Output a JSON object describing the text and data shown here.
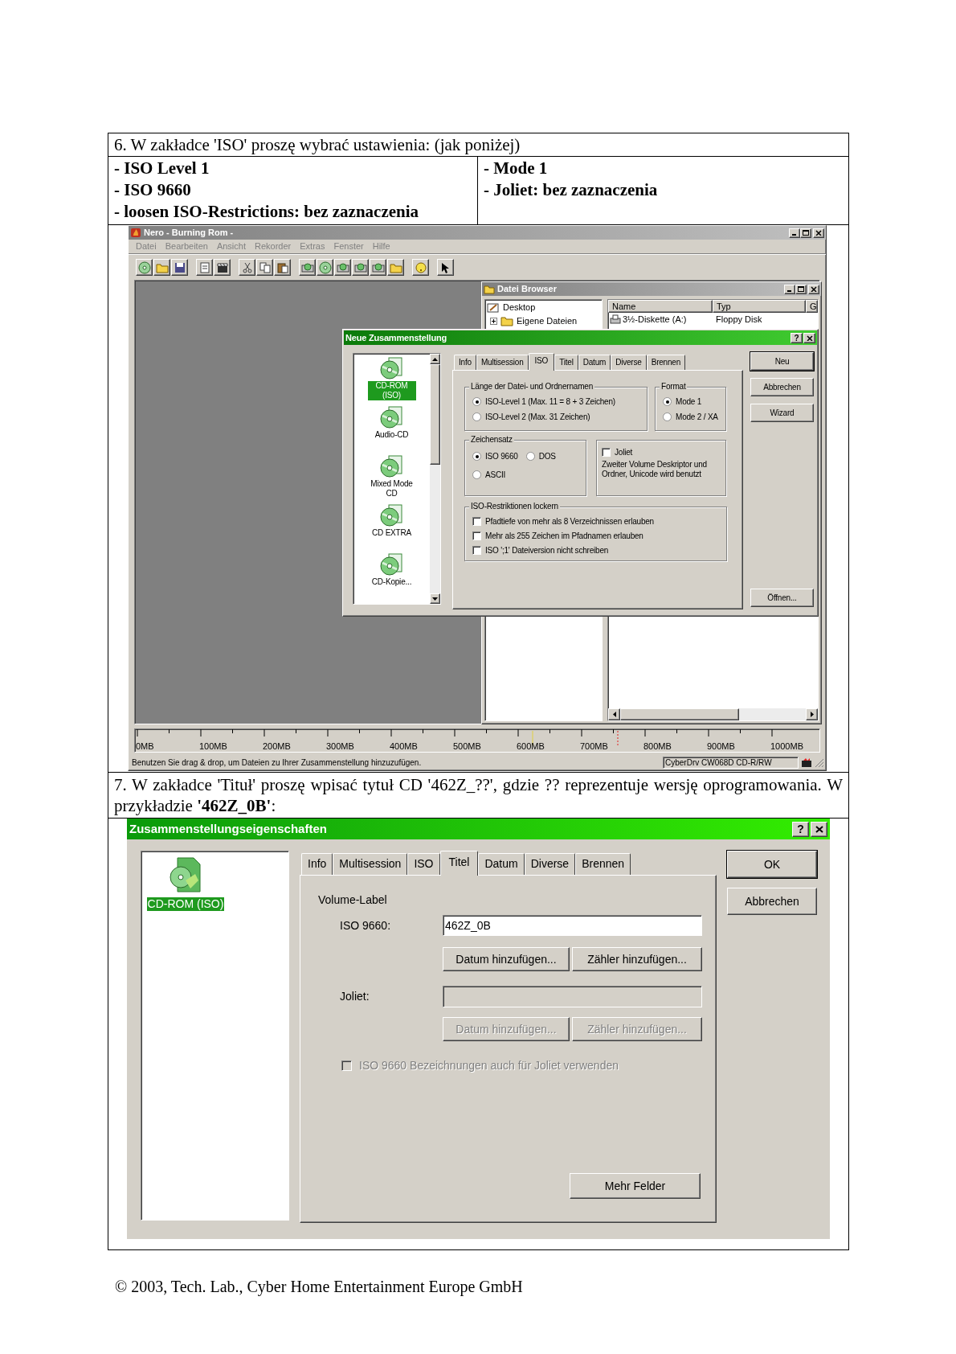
{
  "document": {
    "step6_heading": "6. W zakładce 'ISO' proszę wybrać ustawienia: (jak poniżej)",
    "settings_left": [
      "- ISO Level 1",
      "- ISO 9660",
      "- loosen ISO-Restrictions: bez zaznaczenia"
    ],
    "settings_right": [
      "- Mode 1",
      "- Joliet: bez zaznaczenia"
    ],
    "step7_text": "7. W zakładce 'Tituł' proszę wpisać tytuł CD '462Z_??', gdzie ?? reprezentuje wersję oprogramowania. W przykładzie **'462Z_0B'**:",
    "footer": "© 2003, Tech. Lab., Cyber Home Entertainment Europe GmbH"
  },
  "nero_window": {
    "title": "Nero - Burning Rom -",
    "menu": [
      "Datei",
      "Bearbeiten",
      "Ansicht",
      "Rekorder",
      "Extras",
      "Fenster",
      "Hilfe"
    ],
    "file_browser": {
      "title": "Datei Browser",
      "tree": [
        {
          "label": "Desktop",
          "children": [
            {
              "label": "Eigene Dateien",
              "expanded": false
            }
          ]
        }
      ],
      "columns": [
        "Name",
        "Typ",
        "G"
      ],
      "rows": [
        [
          "3½-Diskette (A:)",
          "Floppy Disk"
        ]
      ]
    },
    "ruler": [
      "0MB",
      "100MB",
      "200MB",
      "300MB",
      "400MB",
      "500MB",
      "600MB",
      "700MB",
      "800MB",
      "900MB",
      "1000MB"
    ],
    "status_message": "Benutzen Sie drag & drop, um Dateien zu Ihrer Zusammenstellung hinzuzufügen.",
    "recorder": "CyberDrv CW068D CD-R/RW"
  },
  "new_compilation_dialog": {
    "title": "Neue Zusammenstellung",
    "help": "?",
    "types": [
      {
        "label": "CD-ROM (ISO)",
        "selected": true
      },
      {
        "label": "Audio-CD",
        "selected": false
      },
      {
        "label": "Mixed Mode CD",
        "selected": false
      },
      {
        "label": "CD EXTRA",
        "selected": false
      },
      {
        "label": "CD-Kopie...",
        "selected": false
      }
    ],
    "tabs": [
      {
        "label": "Info",
        "selected": false
      },
      {
        "label": "Multisession",
        "selected": false
      },
      {
        "label": "ISO",
        "selected": true
      },
      {
        "label": "Titel",
        "selected": false
      },
      {
        "label": "Datum",
        "selected": false
      },
      {
        "label": "Diverse",
        "selected": false
      },
      {
        "label": "Brennen",
        "selected": false
      }
    ],
    "name_length": {
      "legend": "Länge der Datei- und Ordnernamen",
      "options": [
        {
          "label": "ISO-Level 1 (Max. 11 = 8 + 3 Zeichen)",
          "selected": true
        },
        {
          "label": "ISO-Level 2 (Max. 31 Zeichen)",
          "selected": false
        }
      ]
    },
    "format": {
      "legend": "Format",
      "options": [
        {
          "label": "Mode 1",
          "selected": true
        },
        {
          "label": "Mode 2 / XA",
          "selected": false
        }
      ]
    },
    "charset": {
      "legend": "Zeichensatz",
      "options": [
        {
          "label": "ISO 9660",
          "selected": true
        },
        {
          "label": "DOS",
          "selected": false
        },
        {
          "label": "ASCII",
          "selected": false
        }
      ]
    },
    "joliet": {
      "label": "Joliet",
      "checked": false,
      "description": "Zweiter Volume Deskriptor und Ordner, Unicode wird benutzt"
    },
    "restrictions": {
      "legend": "ISO-Restriktionen lockern",
      "options": [
        {
          "label": "Pfadtiefe von mehr als 8 Verzeichnissen erlauben",
          "checked": false
        },
        {
          "label": "Mehr als 255 Zeichen im Pfadnamen erlauben",
          "checked": false
        },
        {
          "label": "ISO ';1' Dateiversion nicht schreiben",
          "checked": false
        }
      ]
    },
    "buttons": [
      {
        "label": "Neu",
        "default": true
      },
      {
        "label": "Abbrechen",
        "default": false
      },
      {
        "label": "Wizard",
        "default": false
      }
    ],
    "open_button": "Öffnen..."
  },
  "properties_dialog": {
    "title": "Zusammenstellungseigenschaften",
    "help": "?",
    "types": [
      {
        "label": "CD-ROM (ISO)",
        "selected": true
      }
    ],
    "tabs": [
      {
        "label": "Info",
        "selected": false
      },
      {
        "label": "Multisession",
        "selected": false
      },
      {
        "label": "ISO",
        "selected": false
      },
      {
        "label": "Titel",
        "selected": true
      },
      {
        "label": "Datum",
        "selected": false
      },
      {
        "label": "Diverse",
        "selected": false
      },
      {
        "label": "Brennen",
        "selected": false
      }
    ],
    "volume_label": "Volume-Label",
    "iso_label": "ISO 9660:",
    "iso_value": "462Z_0B",
    "iso_buttons": [
      {
        "label": "Datum hinzufügen...",
        "disabled": false
      },
      {
        "label": "Zähler hinzufügen...",
        "disabled": false
      }
    ],
    "joliet_label": "Joliet:",
    "joliet_disabled": true,
    "joliet_buttons": [
      {
        "label": "Datum hinzufügen...",
        "disabled": true
      },
      {
        "label": "Zähler hinzufügen...",
        "disabled": true
      }
    ],
    "same_names": {
      "label": "ISO 9660 Bezeichnungen auch für Joliet verwenden",
      "checked": false,
      "disabled": true
    },
    "buttons": [
      {
        "label": "OK",
        "default": true
      },
      {
        "label": "Abbrechen",
        "default": false
      }
    ],
    "more_button": "Mehr Felder"
  }
}
